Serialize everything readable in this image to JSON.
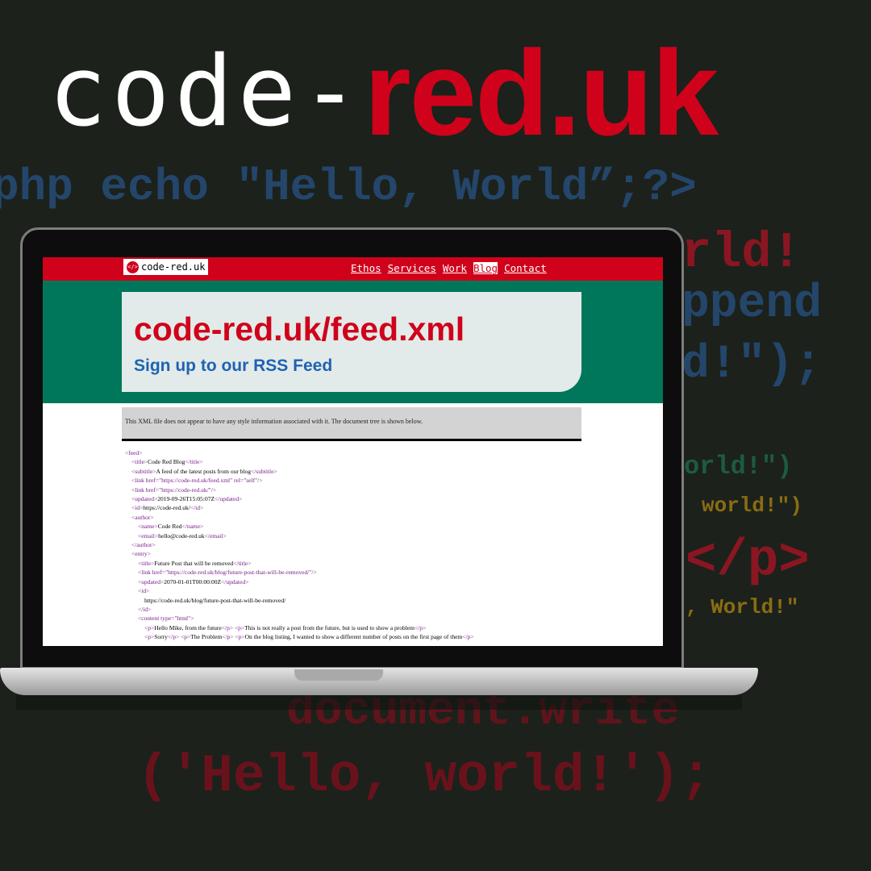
{
  "brand": {
    "prefix": "code-",
    "suffix": "red.uk"
  },
  "background_code": [
    "php echo \"Hello, World”;?>",
    "rld!",
    "ppend",
    "d!\");",
    "orld!\")",
    "world!\")",
    "</p>",
    ", World!\"",
    "document.write",
    "('Hello, world!');"
  ],
  "site": {
    "logo_icon": "</>",
    "logo_text": "code-red.uk",
    "nav": [
      "Ethos",
      "Services",
      "Work",
      "Blog",
      "Contact"
    ],
    "active_nav": "Blog",
    "hero_title": "code-red.uk/feed.xml",
    "hero_subtitle": "Sign up to our RSS Feed",
    "info": "This XML file does not appear to have any style information associated with it. The document tree is shown below."
  },
  "xml_lines": [
    "<feed>",
    "  <title>Code Red Blog</title>",
    "  <subtitle>A feed of the latest posts from our blog</subtitle>",
    "  <link href=\"https://code-red.uk/feed.xml\" rel=\"self\"/>",
    "  <link href=\"https://code-red.uk/\"/>",
    "  <updated>2019-09-26T15:05:07Z</updated>",
    "  <id>https://code-red.uk/</id>",
    "  <author>",
    "    <name>Code Red</name>",
    "    <email>hello@code-red.uk</email>",
    "  </author>",
    "  <entry>",
    "    <title>Future Post that will be removed</title>",
    "    <link href=\"https://code-red.uk/blog/future-post-that-will-be-removed/\"/>",
    "    <updated>2070-01-01T00:00:00Z</updated>",
    "    <id>",
    "      https://code-red.uk/blog/future-post-that-will-be-removed/",
    "    </id>",
    "    <content type=\"html\">",
    "      <p>Hello Mike, from the future</p> <p>This is not really a post from the future, but is used to show a problem</p>",
    "      <p>Sorry</p> <p>The Problem</p> <p>On the blog listing, I wanted to show a different number of posts on the first page of them</p>"
  ]
}
